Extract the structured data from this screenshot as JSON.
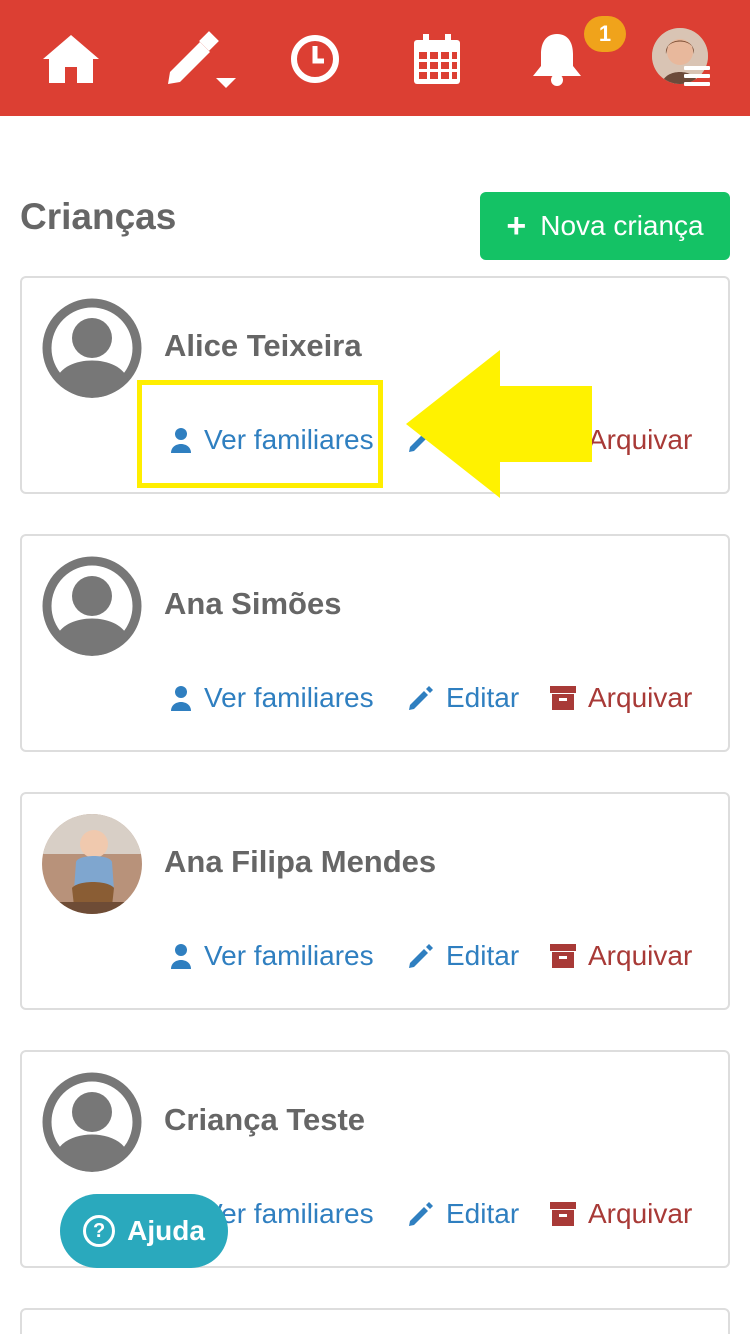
{
  "nav": {
    "icons": [
      "home-icon",
      "edit-dropdown-icon",
      "clock-icon",
      "calendar-icon",
      "bell-icon"
    ],
    "notification_count": "1",
    "accent_color": "#dc3f33"
  },
  "page": {
    "title": "Crianças",
    "new_button_label": "Nova criança"
  },
  "actions": {
    "view_family": "Ver familiares",
    "edit": "Editar",
    "archive": "Arquivar"
  },
  "children": [
    {
      "name": "Alice Teixeira",
      "avatar": "default-avatar-icon"
    },
    {
      "name": "Ana Simões",
      "avatar": "default-avatar-icon"
    },
    {
      "name": "Ana Filipa Mendes",
      "avatar": "photo"
    },
    {
      "name": "Criança Teste",
      "avatar": "default-avatar-icon"
    }
  ],
  "help": {
    "label": "Ajuda"
  }
}
